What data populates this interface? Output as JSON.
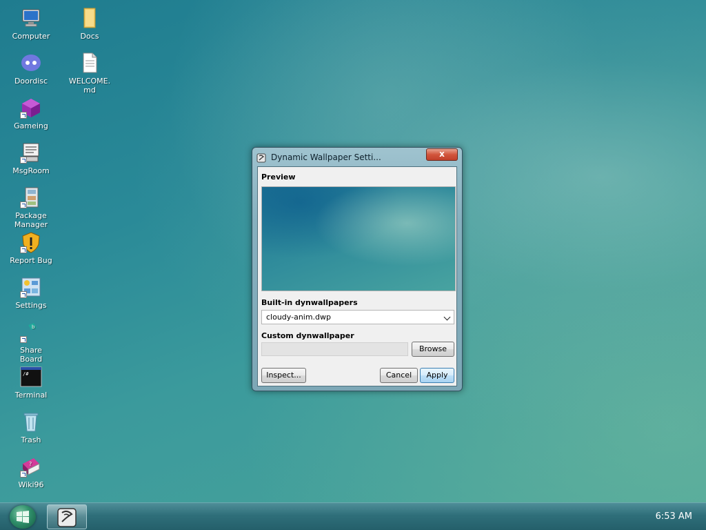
{
  "desktop": {
    "icons": [
      {
        "label": "Computer",
        "icon": "computer-icon"
      },
      {
        "label": "Docs",
        "icon": "folder-icon"
      },
      {
        "label": "Doordisc",
        "icon": "chat-app-icon"
      },
      {
        "label": "WELCOME.\nmd",
        "icon": "text-file-icon"
      },
      {
        "label": "Gameing",
        "icon": "cube-icon"
      },
      {
        "label": "MsgRoom",
        "icon": "messaging-icon"
      },
      {
        "label": "Package\nManager",
        "icon": "package-icon"
      },
      {
        "label": "Report Bug",
        "icon": "warning-shield-icon"
      },
      {
        "label": "Settings",
        "icon": "settings-icon"
      },
      {
        "label": "Share\nBoard",
        "icon": "share-icon"
      },
      {
        "label": "Terminal",
        "icon": "terminal-icon"
      },
      {
        "label": "Trash",
        "icon": "trash-icon"
      },
      {
        "label": "Wiki96",
        "icon": "book-icon"
      }
    ]
  },
  "window": {
    "title": "Dynamic Wallpaper Setti...",
    "close_glyph": "x",
    "preview_label": "Preview",
    "builtin_label": "Built-in dynwallpapers",
    "builtin_value": "cloudy-anim.dwp",
    "custom_label": "Custom dynwallpaper",
    "custom_value": "",
    "browse_label": "Browse",
    "inspect_label": "Inspect...",
    "cancel_label": "Cancel",
    "apply_label": "Apply"
  },
  "taskbar": {
    "clock": "6:53  AM"
  },
  "colors": {
    "desktop_accent": "#2a8a98",
    "close_button": "#d2553c",
    "apply_button": "#bfe0f7"
  }
}
